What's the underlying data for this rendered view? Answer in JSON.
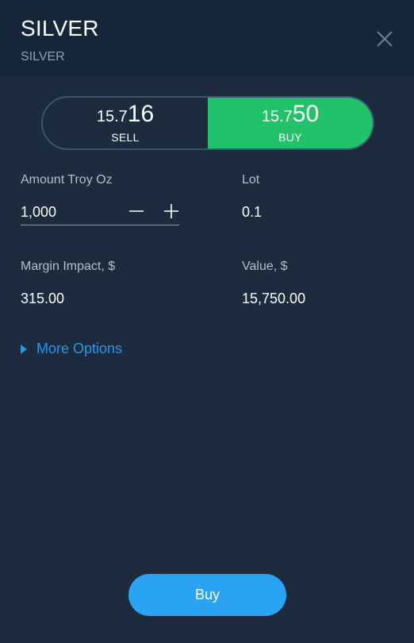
{
  "header": {
    "title": "SILVER",
    "subtitle": "SILVER",
    "close_icon": "close-icon"
  },
  "quote": {
    "sell": {
      "price_prefix": "15.7",
      "price_suffix": "16",
      "label": "SELL"
    },
    "buy": {
      "price_prefix": "15.7",
      "price_suffix": "50",
      "label": "BUY"
    },
    "selected": "buy",
    "buy_color": "#21c26a"
  },
  "order": {
    "amount_label": "Amount Troy Oz",
    "amount_value": "1,000",
    "decrement_icon": "minus-icon",
    "increment_icon": "plus-icon",
    "lot_label": "Lot",
    "lot_value": "0.1",
    "margin_label": "Margin Impact, $",
    "margin_value": "315.00",
    "value_label": "Value, $",
    "value_value": "15,750.00"
  },
  "more_options": {
    "label": "More Options",
    "icon": "caret-right-icon"
  },
  "submit": {
    "label": "Buy",
    "color": "#2aa3f2"
  }
}
